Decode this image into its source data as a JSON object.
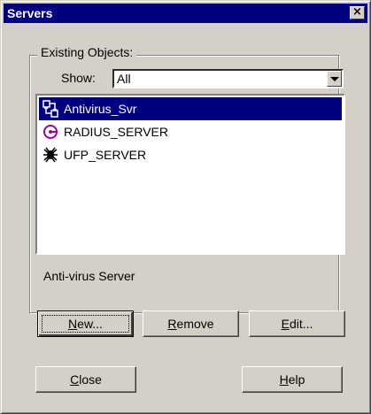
{
  "window": {
    "title": "Servers",
    "close_label": "×"
  },
  "group": {
    "label": "Existing Objects:"
  },
  "filter": {
    "label": "Show:",
    "value": "All"
  },
  "list": {
    "items": [
      {
        "label": "Antivirus_Svr",
        "icon": "antivirus-server-icon",
        "selected": true
      },
      {
        "label": "RADIUS_SERVER",
        "icon": "radius-server-icon",
        "selected": false
      },
      {
        "label": "UFP_SERVER",
        "icon": "ufp-server-icon",
        "selected": false
      }
    ]
  },
  "description": "Anti-virus Server",
  "buttons": {
    "new_mn": "N",
    "new_rest": "ew...",
    "remove_mn": "R",
    "remove_rest": "emove",
    "edit_mn": "E",
    "edit_rest": "dit...",
    "close_mn": "C",
    "close_rest": "lose",
    "help_mn": "H",
    "help_rest": "elp"
  },
  "colors": {
    "selection": "#000080",
    "titlebar": "#000080",
    "face": "#d4d0c8",
    "radius_icon": "#a000a0"
  }
}
